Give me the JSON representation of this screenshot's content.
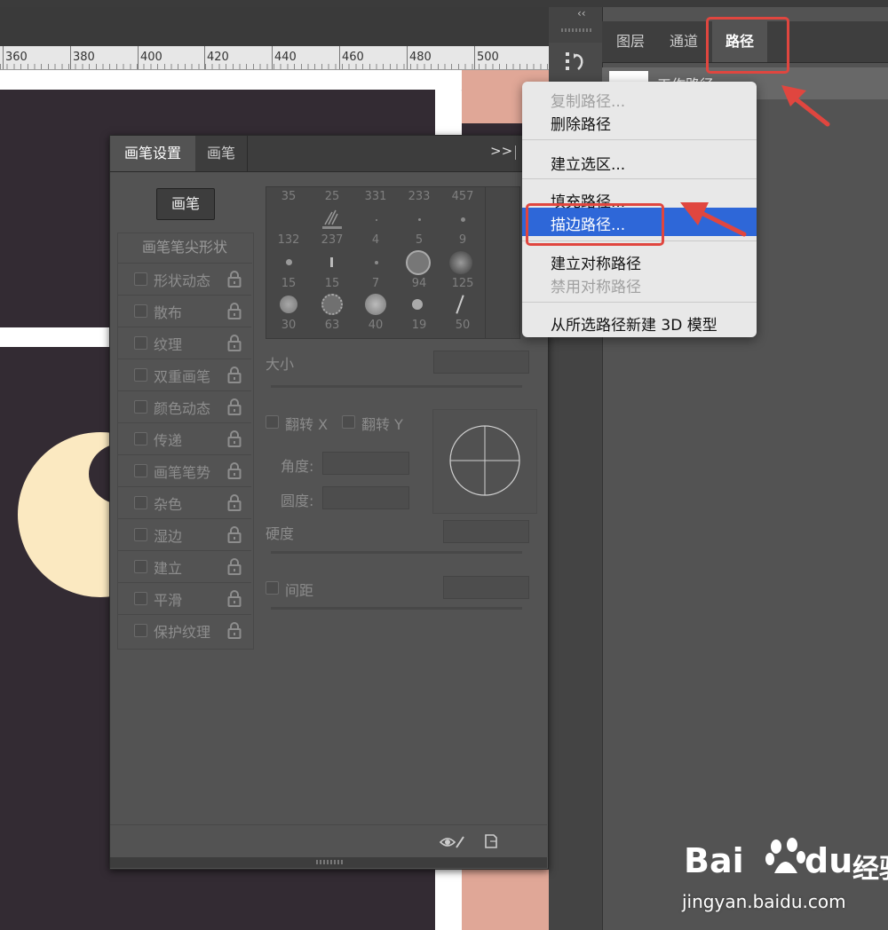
{
  "ruler": {
    "labels": [
      "360",
      "380",
      "400",
      "420",
      "440",
      "460",
      "480",
      "500"
    ]
  },
  "rightPanel": {
    "collapse": "‹‹",
    "tabs": [
      "图层",
      "通道",
      "路径"
    ],
    "activeTab": "路径",
    "pathItem": "工作路径"
  },
  "brushPanel": {
    "tabs": [
      "画笔设置",
      "画笔"
    ],
    "more": ">>",
    "brushButton": "画笔",
    "tipShapeHeader": "画笔笔尖形状",
    "options": [
      "形状动态",
      "散布",
      "纹理",
      "双重画笔",
      "颜色动态",
      "传递",
      "画笔笔势",
      "杂色",
      "湿边",
      "建立",
      "平滑",
      "保护纹理"
    ],
    "tipSizes": [
      [
        "35",
        "25",
        "331",
        "233",
        "457"
      ],
      [
        "132",
        "237",
        "4",
        "5",
        "9"
      ],
      [
        "15",
        "15",
        "7",
        "94",
        "125"
      ],
      [
        "30",
        "63",
        "40",
        "19",
        "50"
      ]
    ],
    "size": "大小",
    "flipX": "翻转 X",
    "flipY": "翻转 Y",
    "angle": "角度:",
    "roundness": "圆度:",
    "hardness": "硬度",
    "spacing": "间距"
  },
  "contextMenu": {
    "items": [
      {
        "label": "复制路径...",
        "disabled": true
      },
      {
        "label": "删除路径",
        "disabled": false
      },
      {
        "label": "建立选区...",
        "disabled": false
      },
      {
        "label": "填充路径...",
        "disabled": false
      },
      {
        "label": "描边路径...",
        "disabled": false,
        "highlighted": true
      },
      {
        "label": "建立对称路径",
        "disabled": false
      },
      {
        "label": "禁用对称路径",
        "disabled": true
      },
      {
        "label": "从所选路径新建 3D 模型",
        "disabled": false
      }
    ]
  },
  "watermark": {
    "brand": "Bai",
    "brand2": "du",
    "cn": "经验",
    "url": "jingyan.baidu.com"
  },
  "colors": {
    "accent": "#2e67d8",
    "annotation": "#e0463f",
    "salmon": "#e0a797",
    "moon": "#fbe9c1"
  }
}
